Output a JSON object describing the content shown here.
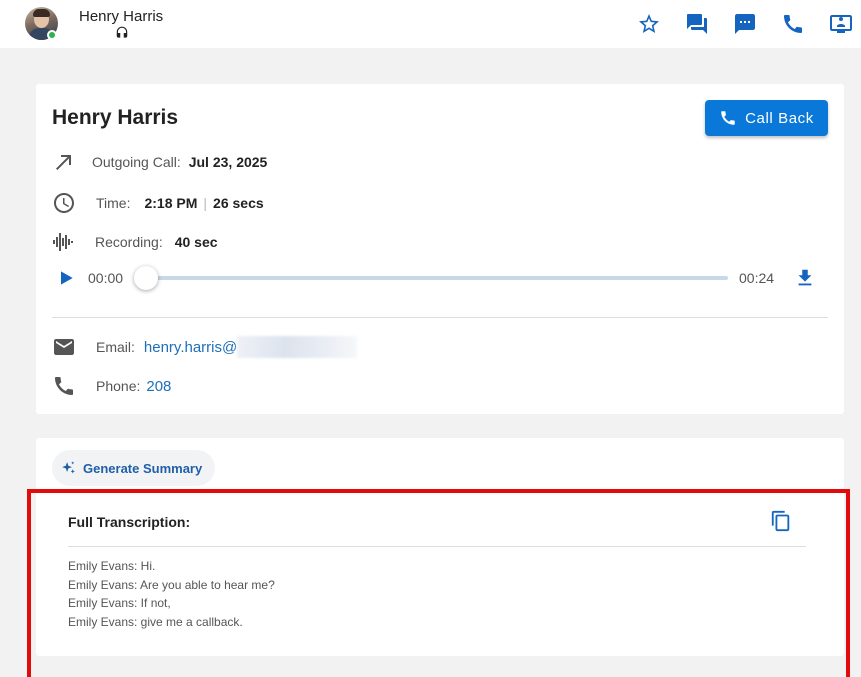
{
  "header": {
    "user_name": "Henry Harris",
    "status_color": "#2fb24a",
    "icons": [
      "star-icon",
      "chat-icon",
      "sms-icon",
      "phone-icon",
      "screen-share-icon"
    ]
  },
  "call": {
    "contact_name": "Henry Harris",
    "callback_label": "Call Back",
    "direction_label": "Outgoing Call:",
    "date": "Jul 23, 2025",
    "time_label": "Time:",
    "time": "2:18 PM",
    "duration": "26 secs",
    "recording_label": "Recording:",
    "recording_length": "40 sec",
    "player": {
      "current": "00:00",
      "total": "00:24",
      "progress": 0
    },
    "email_label": "Email:",
    "email": "henry.harris@",
    "phone_label": "Phone:",
    "phone": "208"
  },
  "summary": {
    "generate_label": "Generate Summary",
    "transcription_title": "Full Transcription:",
    "lines": [
      "Emily Evans: Hi.",
      "Emily Evans: Are you able to hear me?",
      "Emily Evans: If not,",
      "Emily Evans: give me a callback."
    ]
  },
  "colors": {
    "accent": "#0a78d8",
    "link": "#1e6fb8",
    "highlight": "#e20a0a"
  }
}
